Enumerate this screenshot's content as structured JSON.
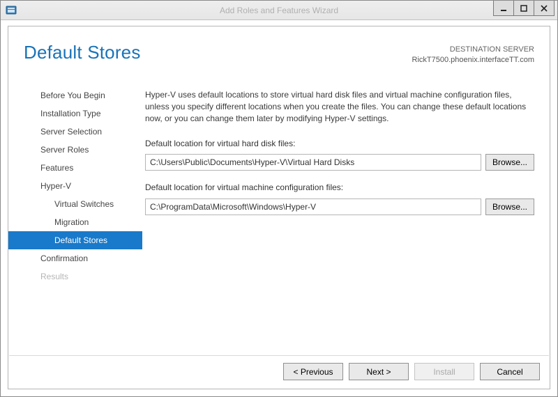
{
  "window": {
    "title": "Add Roles and Features Wizard"
  },
  "header": {
    "page_title": "Default Stores",
    "destination_label": "DESTINATION SERVER",
    "destination_value": "RickT7500.phoenix.interfaceTT.com"
  },
  "sidebar": {
    "items": [
      {
        "label": "Before You Begin",
        "level": "top",
        "state": "normal"
      },
      {
        "label": "Installation Type",
        "level": "top",
        "state": "normal"
      },
      {
        "label": "Server Selection",
        "level": "top",
        "state": "normal"
      },
      {
        "label": "Server Roles",
        "level": "top",
        "state": "normal"
      },
      {
        "label": "Features",
        "level": "top",
        "state": "normal"
      },
      {
        "label": "Hyper-V",
        "level": "top",
        "state": "normal"
      },
      {
        "label": "Virtual Switches",
        "level": "sub",
        "state": "normal"
      },
      {
        "label": "Migration",
        "level": "sub",
        "state": "normal"
      },
      {
        "label": "Default Stores",
        "level": "sub",
        "state": "selected"
      },
      {
        "label": "Confirmation",
        "level": "top",
        "state": "normal"
      },
      {
        "label": "Results",
        "level": "top",
        "state": "disabled"
      }
    ]
  },
  "main": {
    "intro": "Hyper-V uses default locations to store virtual hard disk files and virtual machine configuration files, unless you specify different locations when you create the files. You can change these default locations now, or you can change them later by modifying Hyper-V settings.",
    "vhd_label": "Default location for virtual hard disk files:",
    "vhd_value": "C:\\Users\\Public\\Documents\\Hyper-V\\Virtual Hard Disks",
    "vm_label": "Default location for virtual machine configuration files:",
    "vm_value": "C:\\ProgramData\\Microsoft\\Windows\\Hyper-V",
    "browse_label": "Browse..."
  },
  "footer": {
    "previous": "< Previous",
    "next": "Next >",
    "install": "Install",
    "cancel": "Cancel"
  }
}
